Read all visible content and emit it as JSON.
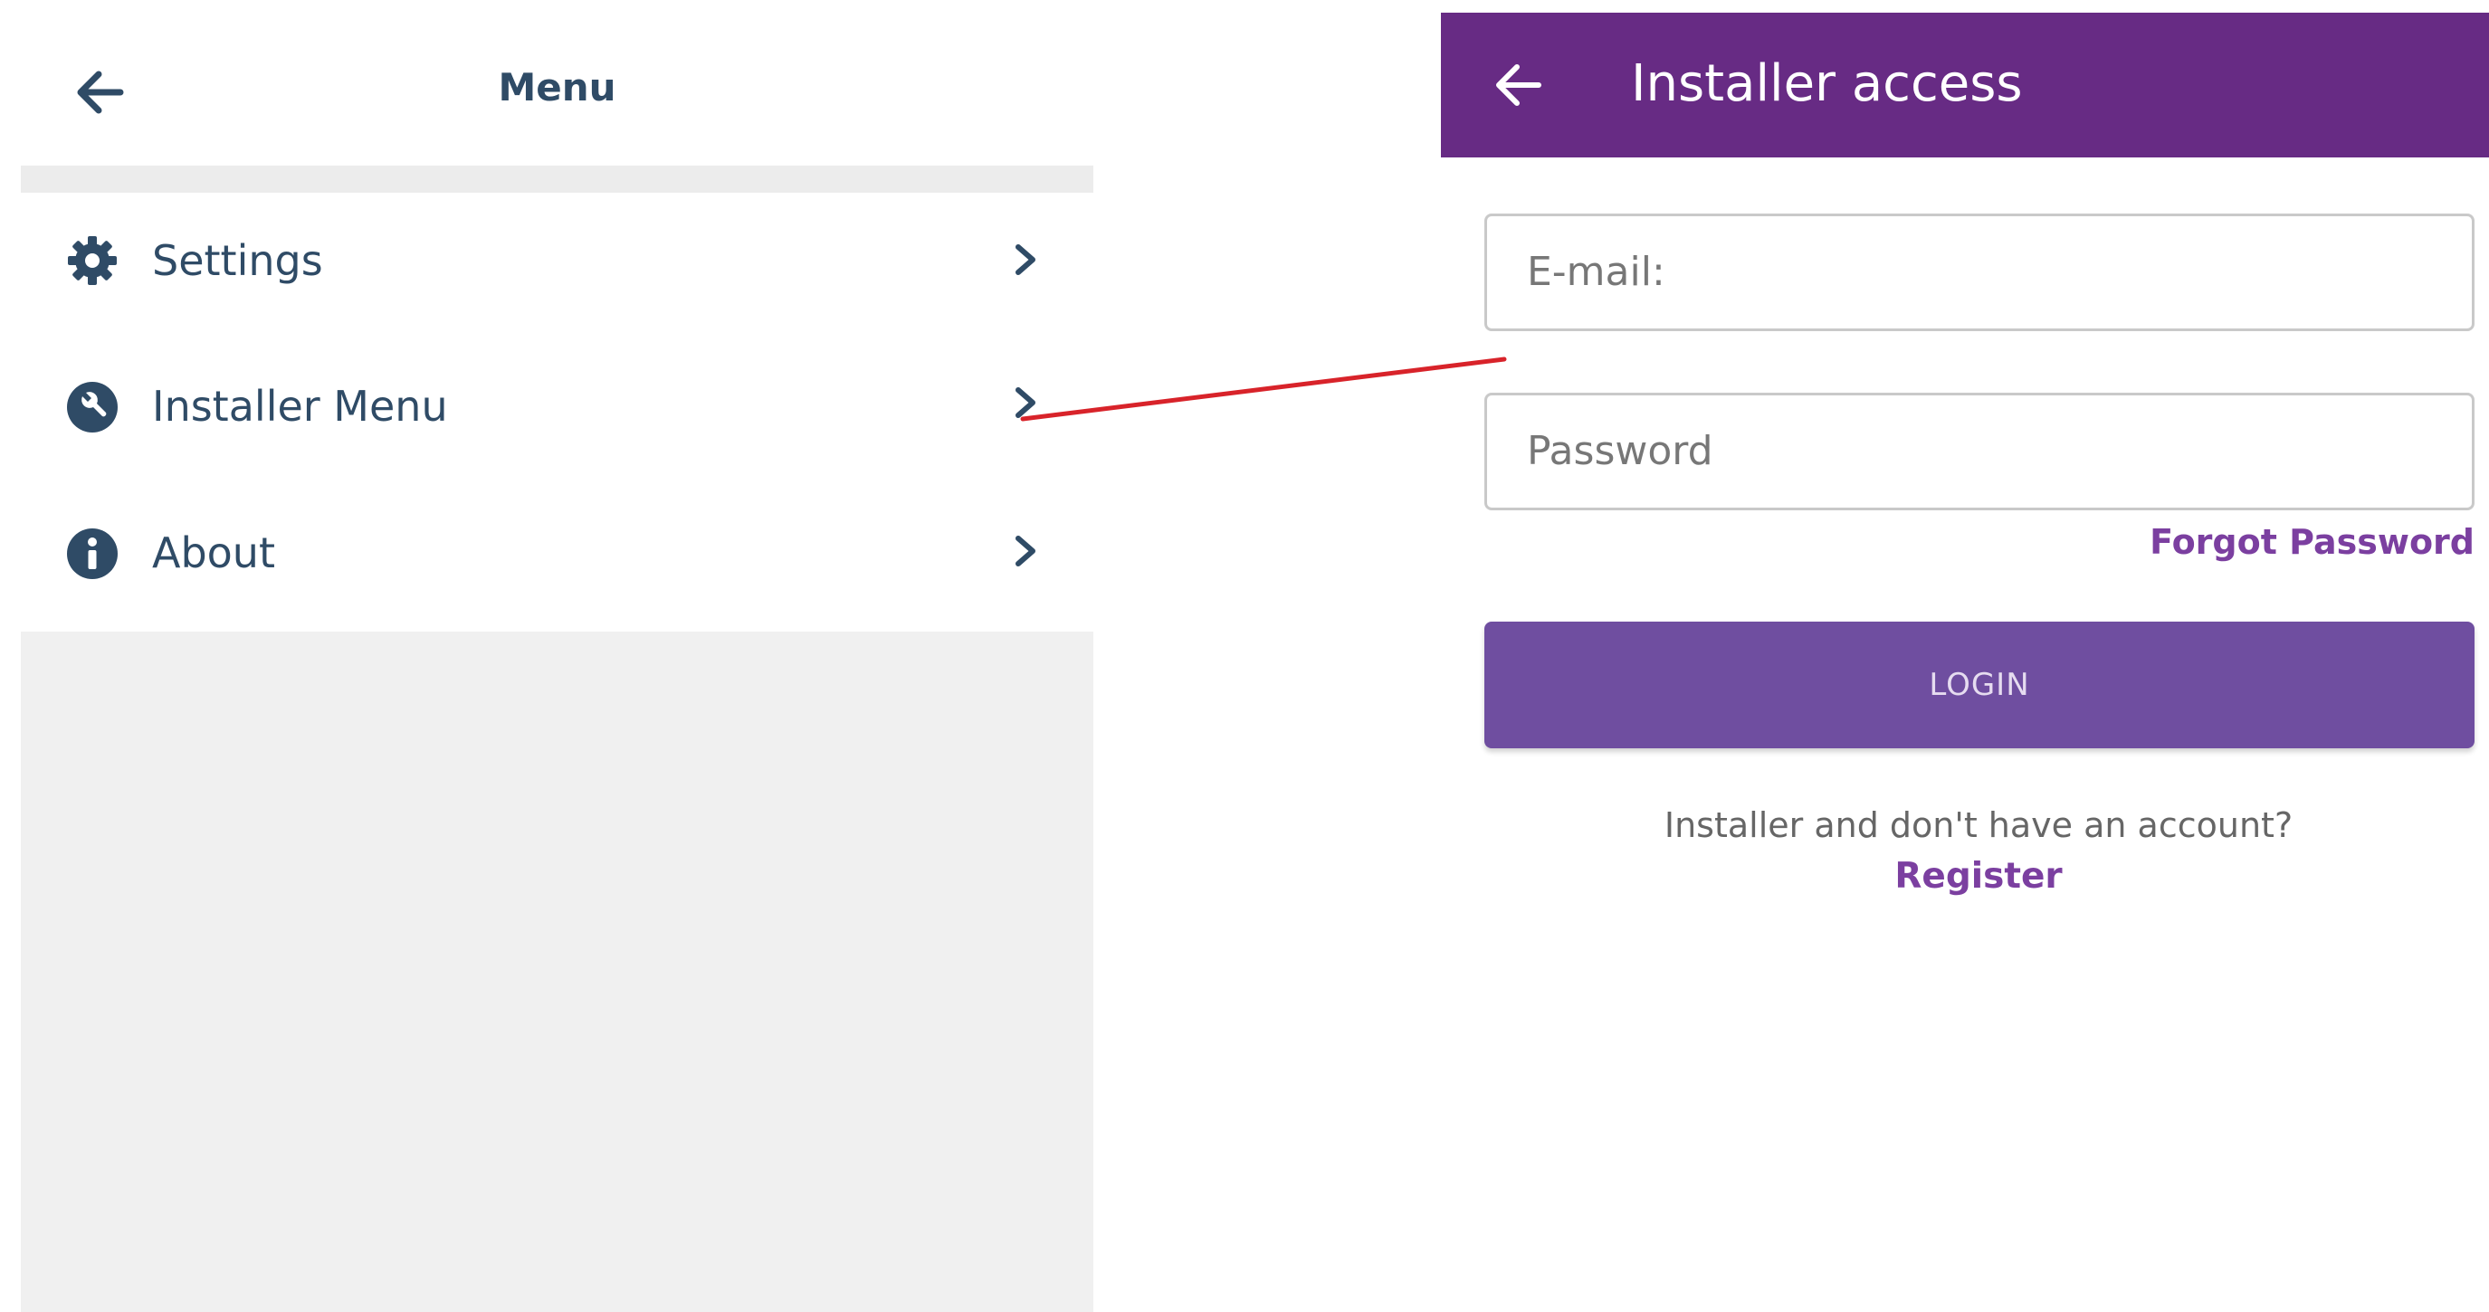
{
  "menu_screen": {
    "title": "Menu",
    "back_icon": "arrow-left-icon",
    "items": [
      {
        "label": "Settings",
        "icon": "gear-icon"
      },
      {
        "label": "Installer Menu",
        "icon": "wrench-icon"
      },
      {
        "label": "About",
        "icon": "info-icon"
      }
    ],
    "chevron_icon": "chevron-right-icon"
  },
  "installer_screen": {
    "title": "Installer access",
    "back_icon": "arrow-left-icon",
    "email_placeholder": "E-mail:",
    "password_placeholder": "Password",
    "forgot_password": "Forgot Password",
    "login_button": "LOGIN",
    "no_account_text": "Installer and don't have an account?",
    "register_link": "Register"
  },
  "colors": {
    "menu_text": "#2f4b66",
    "installer_header": "#672b84",
    "login_button": "#6f4ea0",
    "link": "#7b3fa0",
    "connector": "#d8232a"
  }
}
